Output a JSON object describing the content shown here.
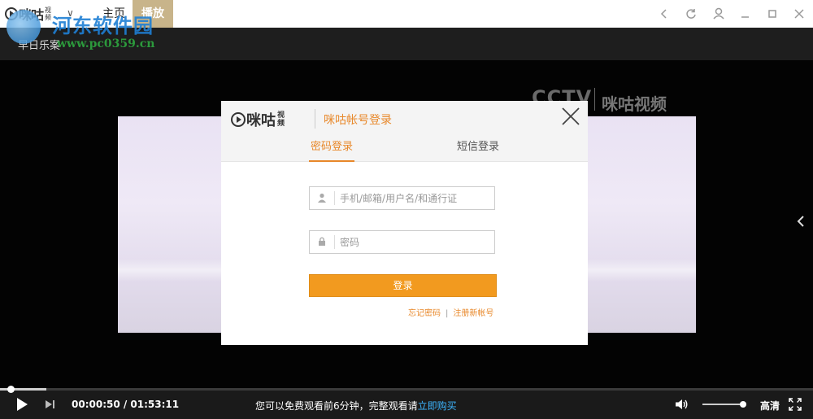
{
  "titlebar": {
    "logo_text": "咪咕",
    "logo_small": "视频",
    "tabs": [
      {
        "label": "主页"
      },
      {
        "label": "播放"
      }
    ],
    "window_buttons": [
      "back-icon",
      "refresh-icon",
      "user-icon",
      "minimize-icon",
      "maximize-icon",
      "close-icon"
    ]
  },
  "watermark": {
    "site_name": "河东软件园",
    "url": "www.pc0359.cn"
  },
  "subbar": {
    "label": "早日乐案"
  },
  "video": {
    "channel_logo": "CCTV",
    "brand_logo": "咪咕视频"
  },
  "login_dialog": {
    "brand": "咪咕",
    "brand_small": "视频",
    "title": "咪咕帐号登录",
    "tabs": [
      {
        "label": "密码登录",
        "active": true
      },
      {
        "label": "短信登录",
        "active": false
      }
    ],
    "username": {
      "value": "",
      "placeholder": "手机/邮箱/用户名/和通行证"
    },
    "password": {
      "value": "",
      "placeholder": "密码"
    },
    "submit_label": "登录",
    "forgot_label": "忘记密码",
    "separator": "|",
    "register_label": "注册新帐号",
    "accent_color": "#e8882a",
    "button_color": "#f29a1f"
  },
  "player": {
    "current_time": "00:00:50",
    "total_time": "01:53:11",
    "time_display": "00:00:50 / 01:53:11",
    "progress_fraction": 0.0074,
    "notice_prefix": "您可以免费观看前6分钟，完整观看请",
    "notice_link": "立即购买",
    "volume_fraction": 1.0,
    "quality_label": "高清",
    "buy_color": "#3db5ff"
  }
}
